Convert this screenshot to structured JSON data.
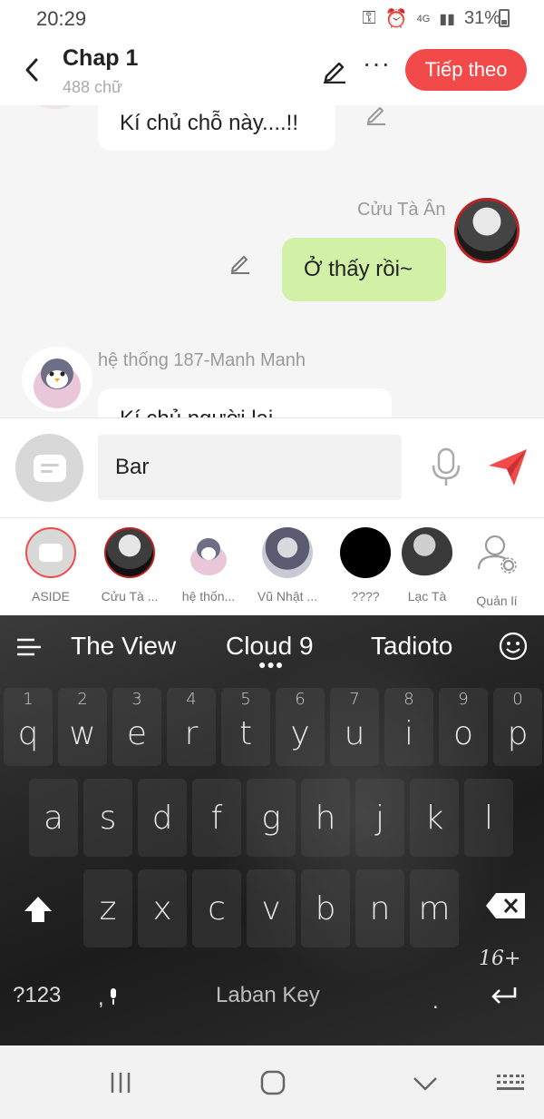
{
  "status_bar": {
    "time": "20:29",
    "network": "4G",
    "battery": "31%"
  },
  "header": {
    "title": "Chap 1",
    "subtitle": "488 chữ",
    "next_label": "Tiếp theo"
  },
  "messages": [
    {
      "text": "Kí chủ chỗ này....!!"
    },
    {
      "sender": "Cửu Tà Ân",
      "text": "Ở thấy rồi~"
    },
    {
      "sender": "hệ thống 187-Manh Manh",
      "text": "Kí chủ người lại"
    }
  ],
  "input": {
    "value": "Bar"
  },
  "characters": [
    {
      "label": "ASIDE"
    },
    {
      "label": "Cửu Tà ..."
    },
    {
      "label": "hệ thốn..."
    },
    {
      "label": "Vũ Nhật ..."
    },
    {
      "label": "????"
    },
    {
      "label": "Lạc Tà"
    },
    {
      "label": "Quản lí"
    }
  ],
  "keyboard": {
    "suggestions": [
      "The View",
      "Cloud 9",
      "Tadioto"
    ],
    "row1": [
      {
        "n": "1",
        "k": "q"
      },
      {
        "n": "2",
        "k": "w"
      },
      {
        "n": "3",
        "k": "e"
      },
      {
        "n": "4",
        "k": "r"
      },
      {
        "n": "5",
        "k": "t"
      },
      {
        "n": "6",
        "k": "y"
      },
      {
        "n": "7",
        "k": "u"
      },
      {
        "n": "8",
        "k": "i"
      },
      {
        "n": "9",
        "k": "o"
      },
      {
        "n": "0",
        "k": "p"
      }
    ],
    "row2": [
      "a",
      "s",
      "d",
      "f",
      "g",
      "h",
      "j",
      "k",
      "l"
    ],
    "row3": [
      "z",
      "x",
      "c",
      "v",
      "b",
      "n",
      "m"
    ],
    "symbols_label": "?123",
    "comma_label": ",",
    "space_label": "Laban Key",
    "period_label": ".",
    "emoji_label": "16+"
  },
  "colors": {
    "accent": "#f24a4a",
    "bubble_me": "#d3f1a6",
    "bubble_other": "#ffffff"
  }
}
